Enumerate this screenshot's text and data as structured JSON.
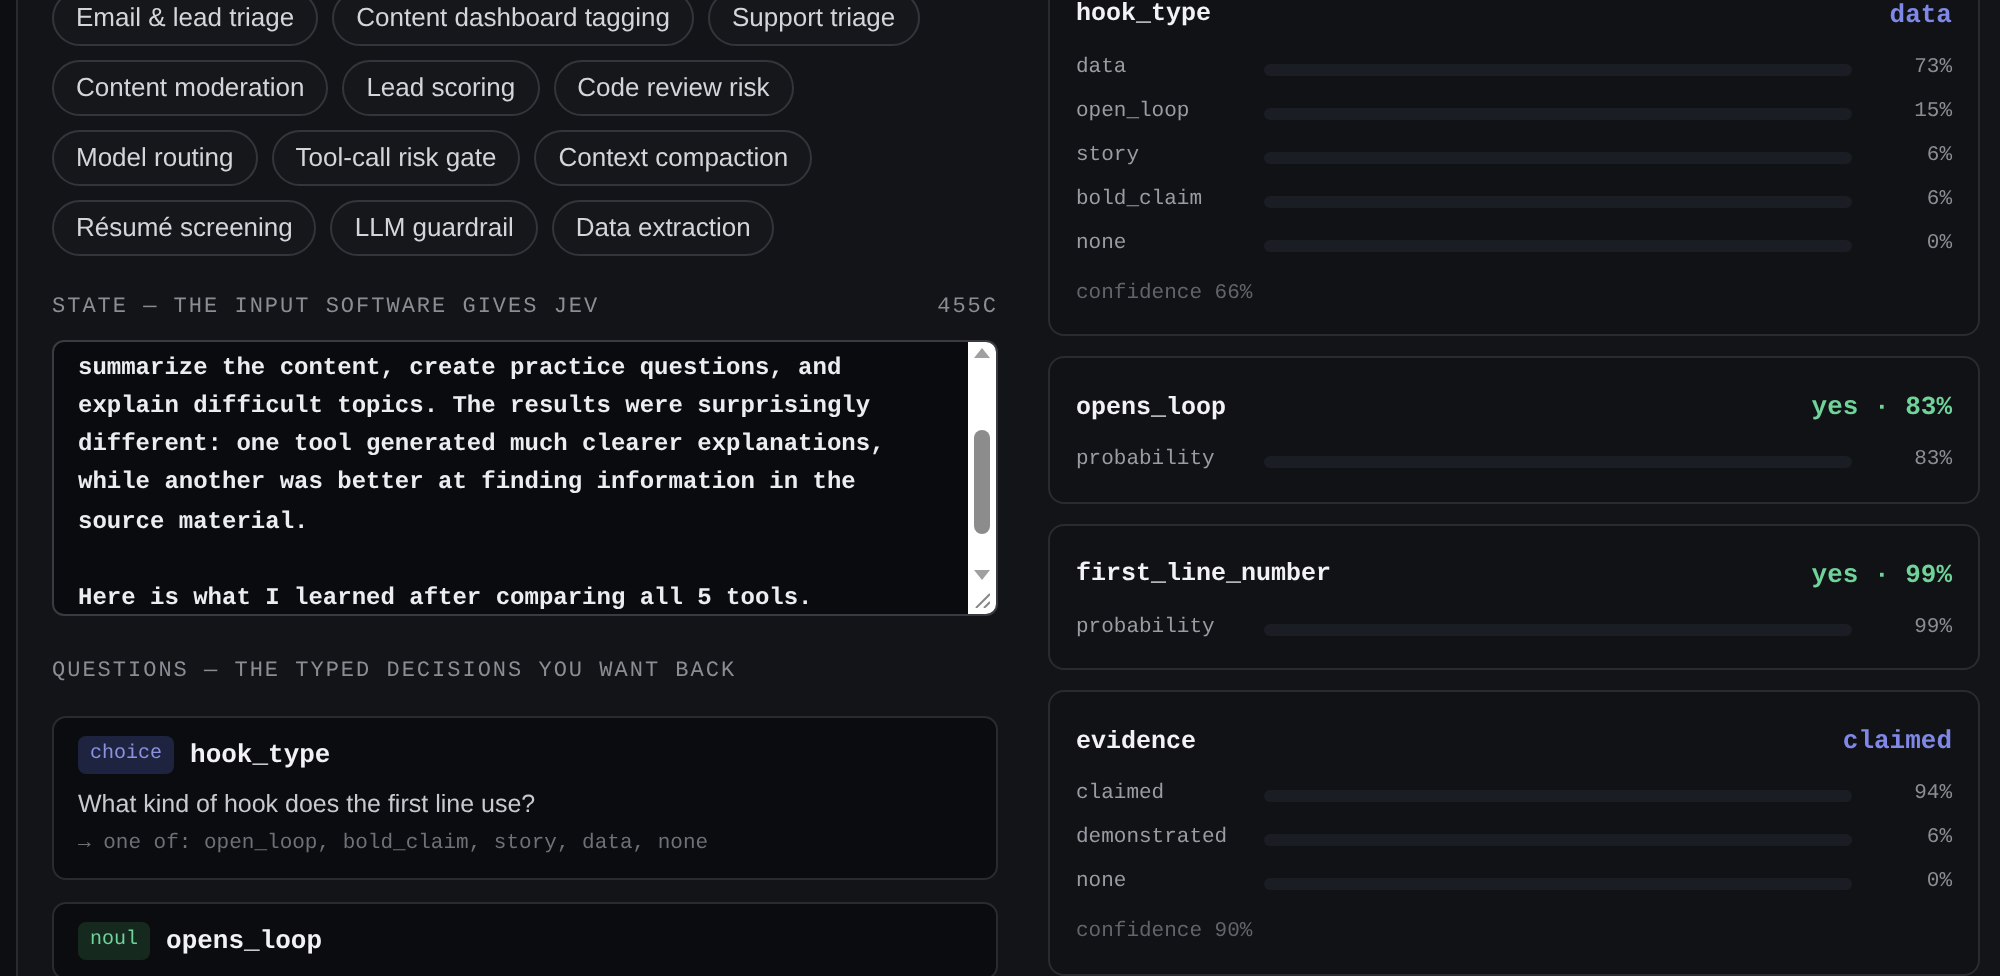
{
  "presets": [
    [
      "Email & lead triage",
      "Content dashboard tagging",
      "Support triage"
    ],
    [
      "Content moderation",
      "Lead scoring",
      "Code review risk"
    ],
    [
      "Model routing",
      "Tool-call risk gate",
      "Context compaction"
    ],
    [
      "Résumé screening",
      "LLM guardrail",
      "Data extraction"
    ]
  ],
  "state": {
    "label": "STATE — THE INPUT SOFTWARE GIVES JEV",
    "count": "455C",
    "value": "summarize the content, create practice questions, and explain difficult topics. The results were surprisingly different: one tool generated much clearer explanations, while another was better at finding information in the source material.\n\nHere is what I learned after comparing all 5 tools."
  },
  "questions_label": "QUESTIONS — THE TYPED DECISIONS YOU WANT BACK",
  "questions": [
    {
      "kind": "choice",
      "tag": "choice",
      "name": "hook_type",
      "prompt": "What kind of hook does the first line use?",
      "hint": "→ one of: open_loop, bold_claim, story, data, none"
    },
    {
      "kind": "bool",
      "tag": "noul",
      "name": "opens_loop"
    }
  ],
  "results": [
    {
      "kind": "choice",
      "name": "hook_type",
      "answer": "data",
      "rows": [
        {
          "label": "data",
          "reading": "73%"
        },
        {
          "label": "open_loop",
          "reading": "15%"
        },
        {
          "label": "story",
          "reading": "6%"
        },
        {
          "label": "bold_claim",
          "reading": "6%"
        },
        {
          "label": "none",
          "reading": "0%"
        }
      ],
      "confidence": "confidence 66%"
    },
    {
      "kind": "bool",
      "name": "opens_loop",
      "answer": "yes · 83%",
      "rows": [
        {
          "label": "probability",
          "reading": "83%"
        }
      ]
    },
    {
      "kind": "bool",
      "name": "first_line_number",
      "answer": "yes · 99%",
      "rows": [
        {
          "label": "probability",
          "reading": "99%"
        }
      ]
    },
    {
      "kind": "choice",
      "name": "evidence",
      "answer": "claimed",
      "rows": [
        {
          "label": "claimed",
          "reading": "94%"
        },
        {
          "label": "demonstrated",
          "reading": "6%"
        },
        {
          "label": "none",
          "reading": "0%"
        }
      ],
      "confidence": "confidence 90%"
    }
  ]
}
